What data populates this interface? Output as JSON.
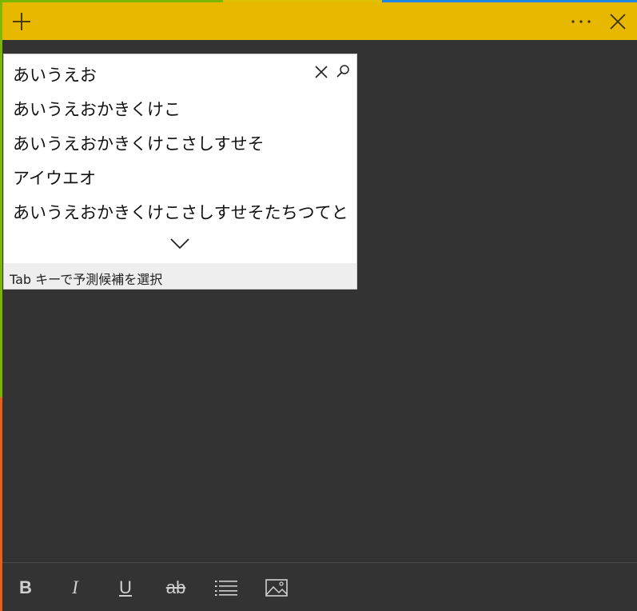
{
  "colors": {
    "accent": "#e6b800",
    "background": "#333333",
    "popup": "#ffffff",
    "hint_bg": "#eeeeee"
  },
  "titlebar": {
    "icons": {
      "add": "plus-icon",
      "more": "more-icon",
      "close": "close-icon"
    }
  },
  "ime": {
    "input_text": "あいうえお",
    "icons": {
      "clear": "clear-icon",
      "search": "search-icon",
      "expand": "chevron-down-icon"
    },
    "candidates": [
      "あいうえおかきくけこ",
      "あいうえおかきくけこさしすせそ",
      "アイウエオ",
      "あいうえおかきくけこさしすせそたちつてと"
    ],
    "hint": "Tab キーで予測候補を選択"
  },
  "toolbar": {
    "bold": "B",
    "italic": "I",
    "underline": "U",
    "strikethrough": "ab",
    "icons": {
      "list": "list-icon",
      "image": "image-icon"
    }
  }
}
